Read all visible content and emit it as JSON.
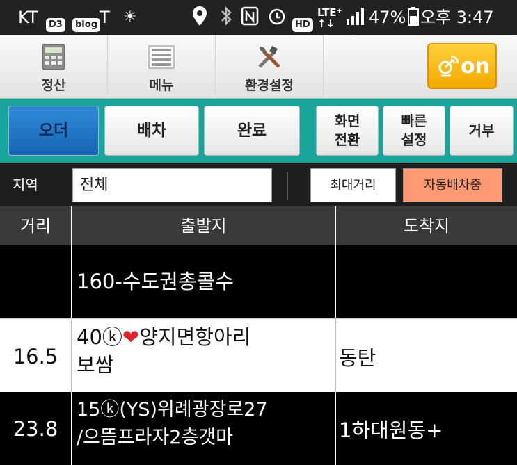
{
  "status_bar": {
    "carrier": "KT",
    "chips": [
      "D3",
      "blog"
    ],
    "battery": "47%",
    "time": "오후 3:47",
    "icons": [
      "t-app-icon",
      "brightness-icon",
      "location-icon",
      "bluetooth-icon",
      "nfc-icon",
      "alarm-icon",
      "hd-icon",
      "lte-icon",
      "signal-icon",
      "battery-icon"
    ]
  },
  "toolbar": {
    "settle_label": "정산",
    "menu_label": "메뉴",
    "settings_label": "환경설정",
    "on_label": "on"
  },
  "tabs": {
    "order": "오더",
    "dispatch": "배차",
    "complete": "완료",
    "screen_switch_line1": "화면",
    "screen_switch_line2": "전환",
    "quick_setup_line1": "빠른",
    "quick_setup_line2": "설정",
    "reject": "거부"
  },
  "filter": {
    "region_label": "지역",
    "region_value": "전체",
    "max_distance": "최대거리",
    "auto_dispatch": "자동배차중"
  },
  "table": {
    "headers": {
      "distance": "거리",
      "origin": "출발지",
      "destination": "도착지"
    },
    "rows": [
      {
        "distance": "",
        "origin": "160-수도권총콜수",
        "destination": ""
      },
      {
        "distance": "16.5",
        "origin_line1": "40ⓚ",
        "origin_line1b": "양지면항아리",
        "origin_line2": "보쌈",
        "destination": "동탄"
      },
      {
        "distance": "23.8",
        "origin_line1": "15ⓚ(YS)위례광장로27",
        "origin_line2": "/으뜸프라자2층갯마",
        "destination": "1하대원동+"
      }
    ]
  },
  "colors": {
    "accent_teal": "#1aa59c",
    "active_tab": "#1f74c6",
    "on_button": "#f5b400",
    "auto_dispatch": "#fd9a73"
  }
}
